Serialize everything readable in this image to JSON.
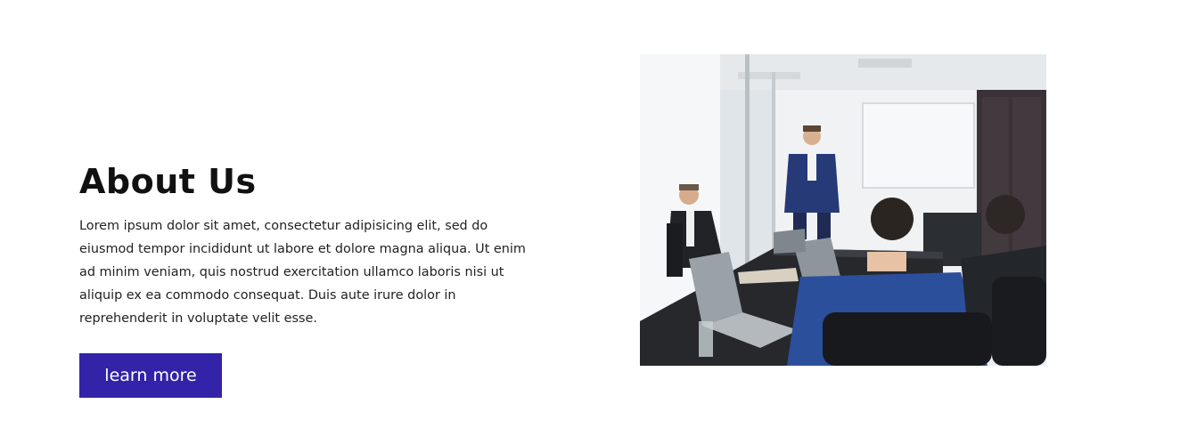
{
  "about": {
    "title": "About Us",
    "body": "Lorem ipsum dolor sit amet, consectetur adipisicing elit, sed do eiusmod tempor incididunt ut labore et dolore magna aliqua. Ut enim ad minim veniam, quis nostrud exercitation ullamco laboris nisi ut aliquip ex ea commodo consequat. Duis aute irure dolor in reprehenderit in voluptate velit esse.",
    "button_label": "learn more"
  },
  "colors": {
    "button_bg": "#3323a8",
    "title": "#111111",
    "body_text": "#222222"
  },
  "image": {
    "subject": "business-meeting-photo"
  }
}
